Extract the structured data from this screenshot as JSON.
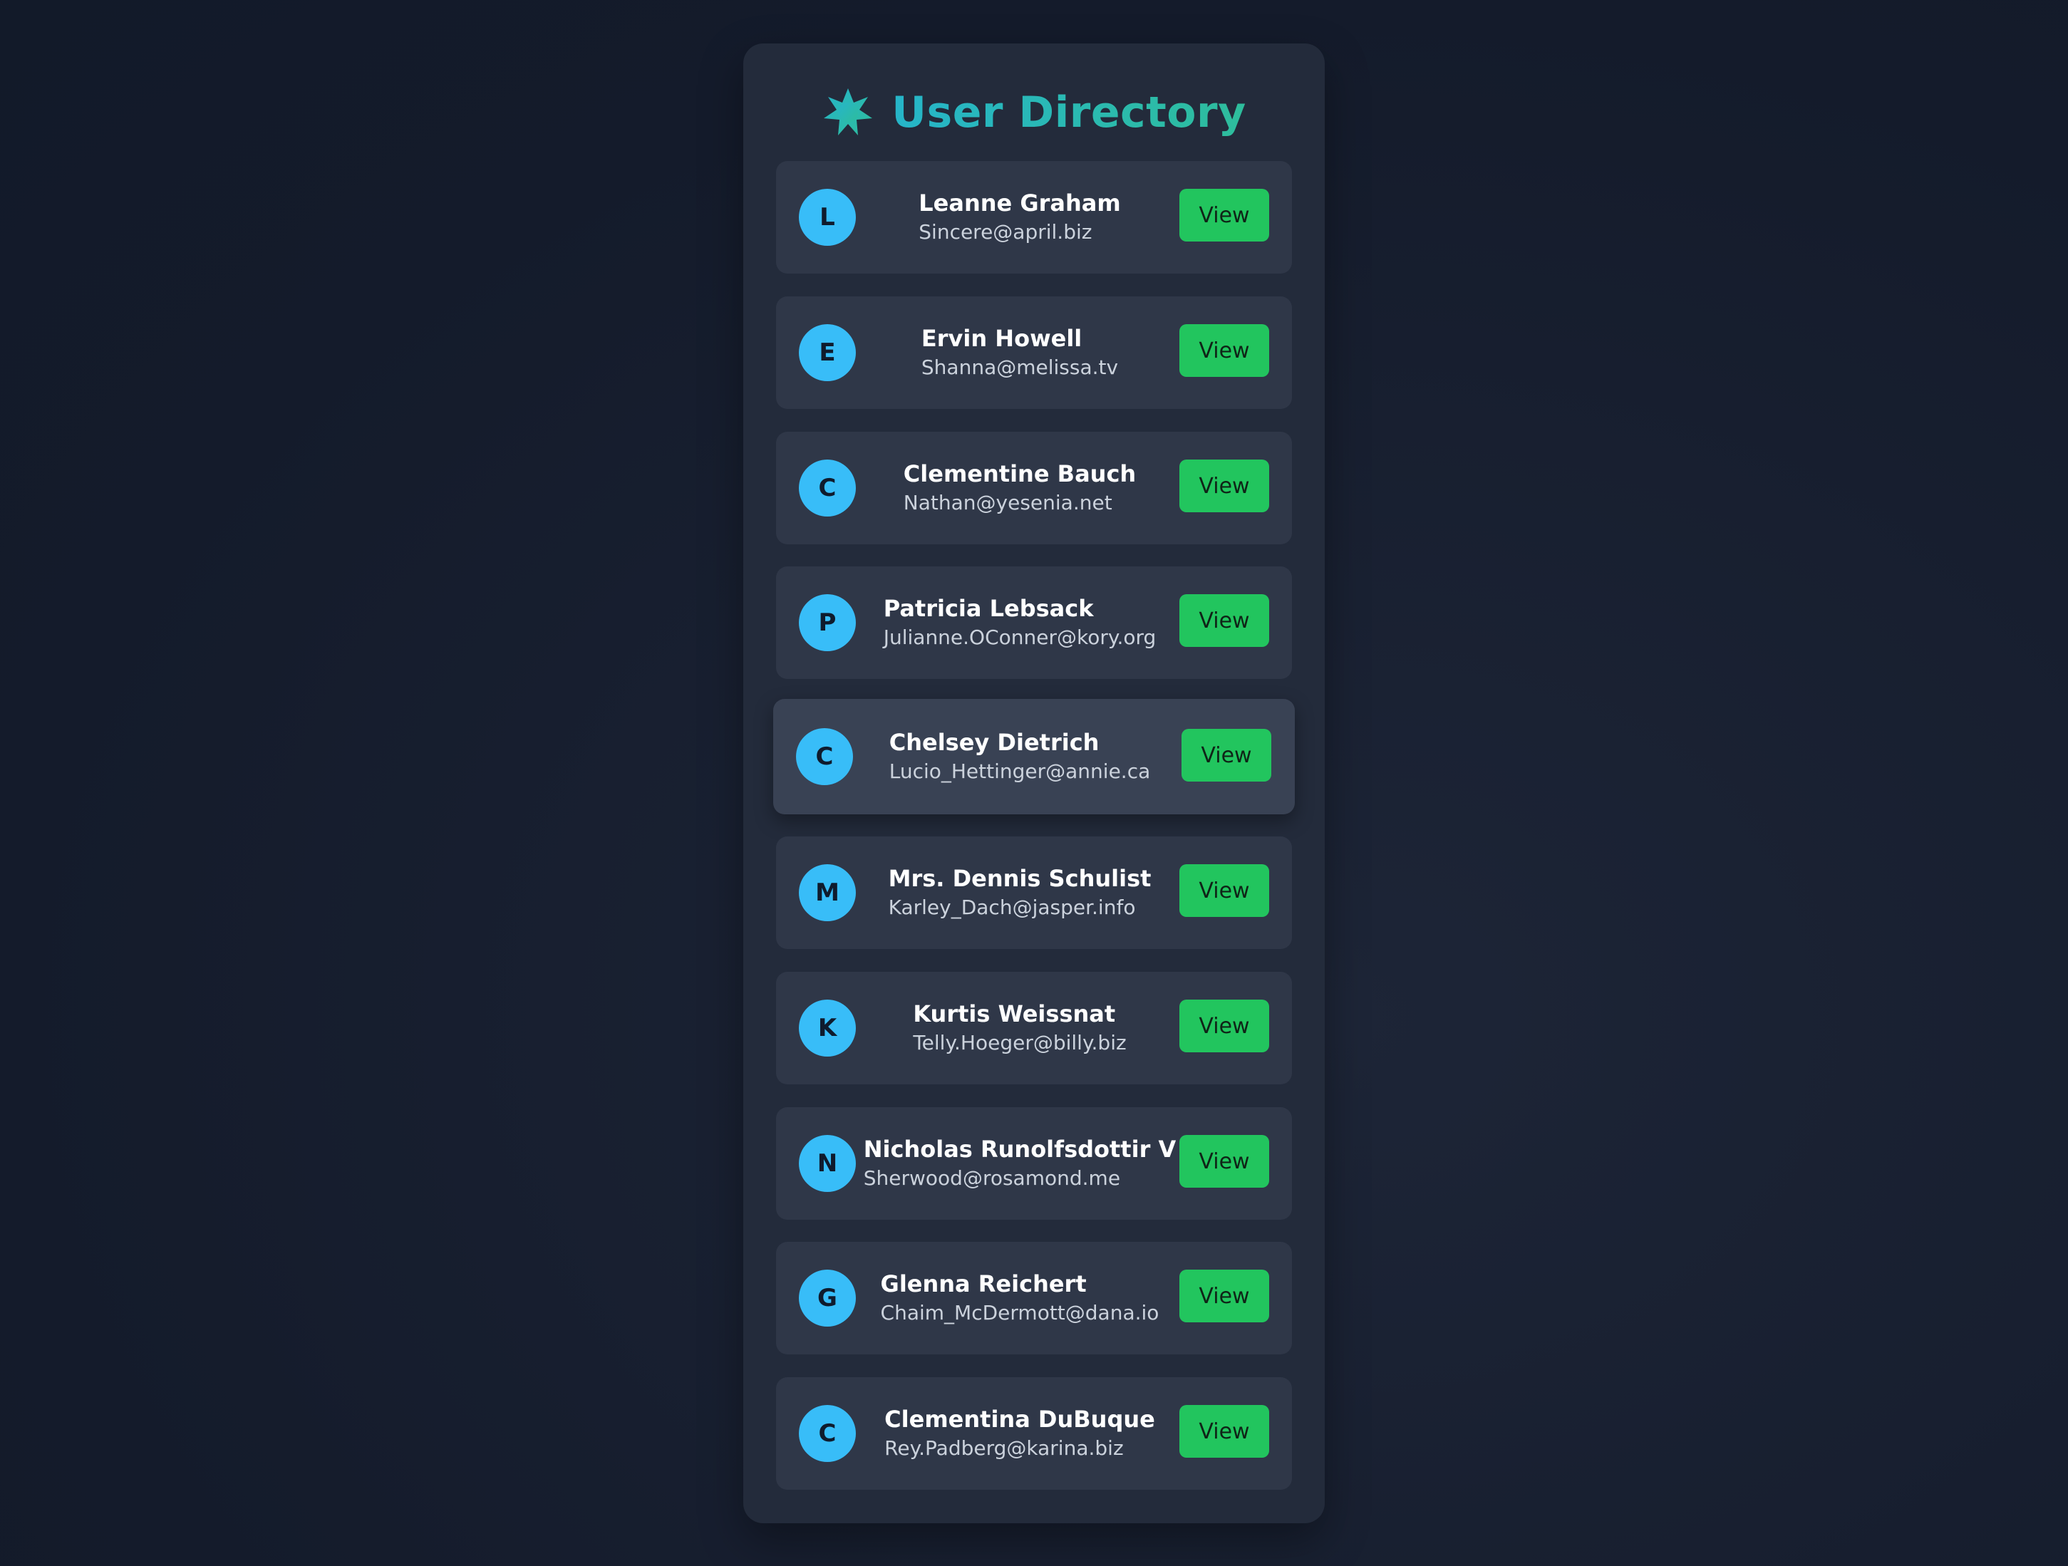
{
  "header": {
    "title": "User Directory",
    "icon": "asterisk-star-icon"
  },
  "colors": {
    "accent_title": "#2cb7a6",
    "avatar": "#38bdf8",
    "button": "#22c55e",
    "card": "#2f3748",
    "panel": "#232b3b",
    "background": "#141b2b"
  },
  "users": [
    {
      "initial": "L",
      "name": "Leanne Graham",
      "email": "Sincere@april.biz",
      "button": "View"
    },
    {
      "initial": "E",
      "name": "Ervin Howell",
      "email": "Shanna@melissa.tv",
      "button": "View"
    },
    {
      "initial": "C",
      "name": "Clementine Bauch",
      "email": "Nathan@yesenia.net",
      "button": "View"
    },
    {
      "initial": "P",
      "name": "Patricia Lebsack",
      "email": "Julianne.OConner@kory.org",
      "button": "View"
    },
    {
      "initial": "C",
      "name": "Chelsey Dietrich",
      "email": "Lucio_Hettinger@annie.ca",
      "button": "View"
    },
    {
      "initial": "M",
      "name": "Mrs. Dennis Schulist",
      "email": "Karley_Dach@jasper.info",
      "button": "View"
    },
    {
      "initial": "K",
      "name": "Kurtis Weissnat",
      "email": "Telly.Hoeger@billy.biz",
      "button": "View"
    },
    {
      "initial": "N",
      "name": "Nicholas Runolfsdottir V",
      "email": "Sherwood@rosamond.me",
      "button": "View"
    },
    {
      "initial": "G",
      "name": "Glenna Reichert",
      "email": "Chaim_McDermott@dana.io",
      "button": "View"
    },
    {
      "initial": "C",
      "name": "Clementina DuBuque",
      "email": "Rey.Padberg@karina.biz",
      "button": "View"
    }
  ]
}
